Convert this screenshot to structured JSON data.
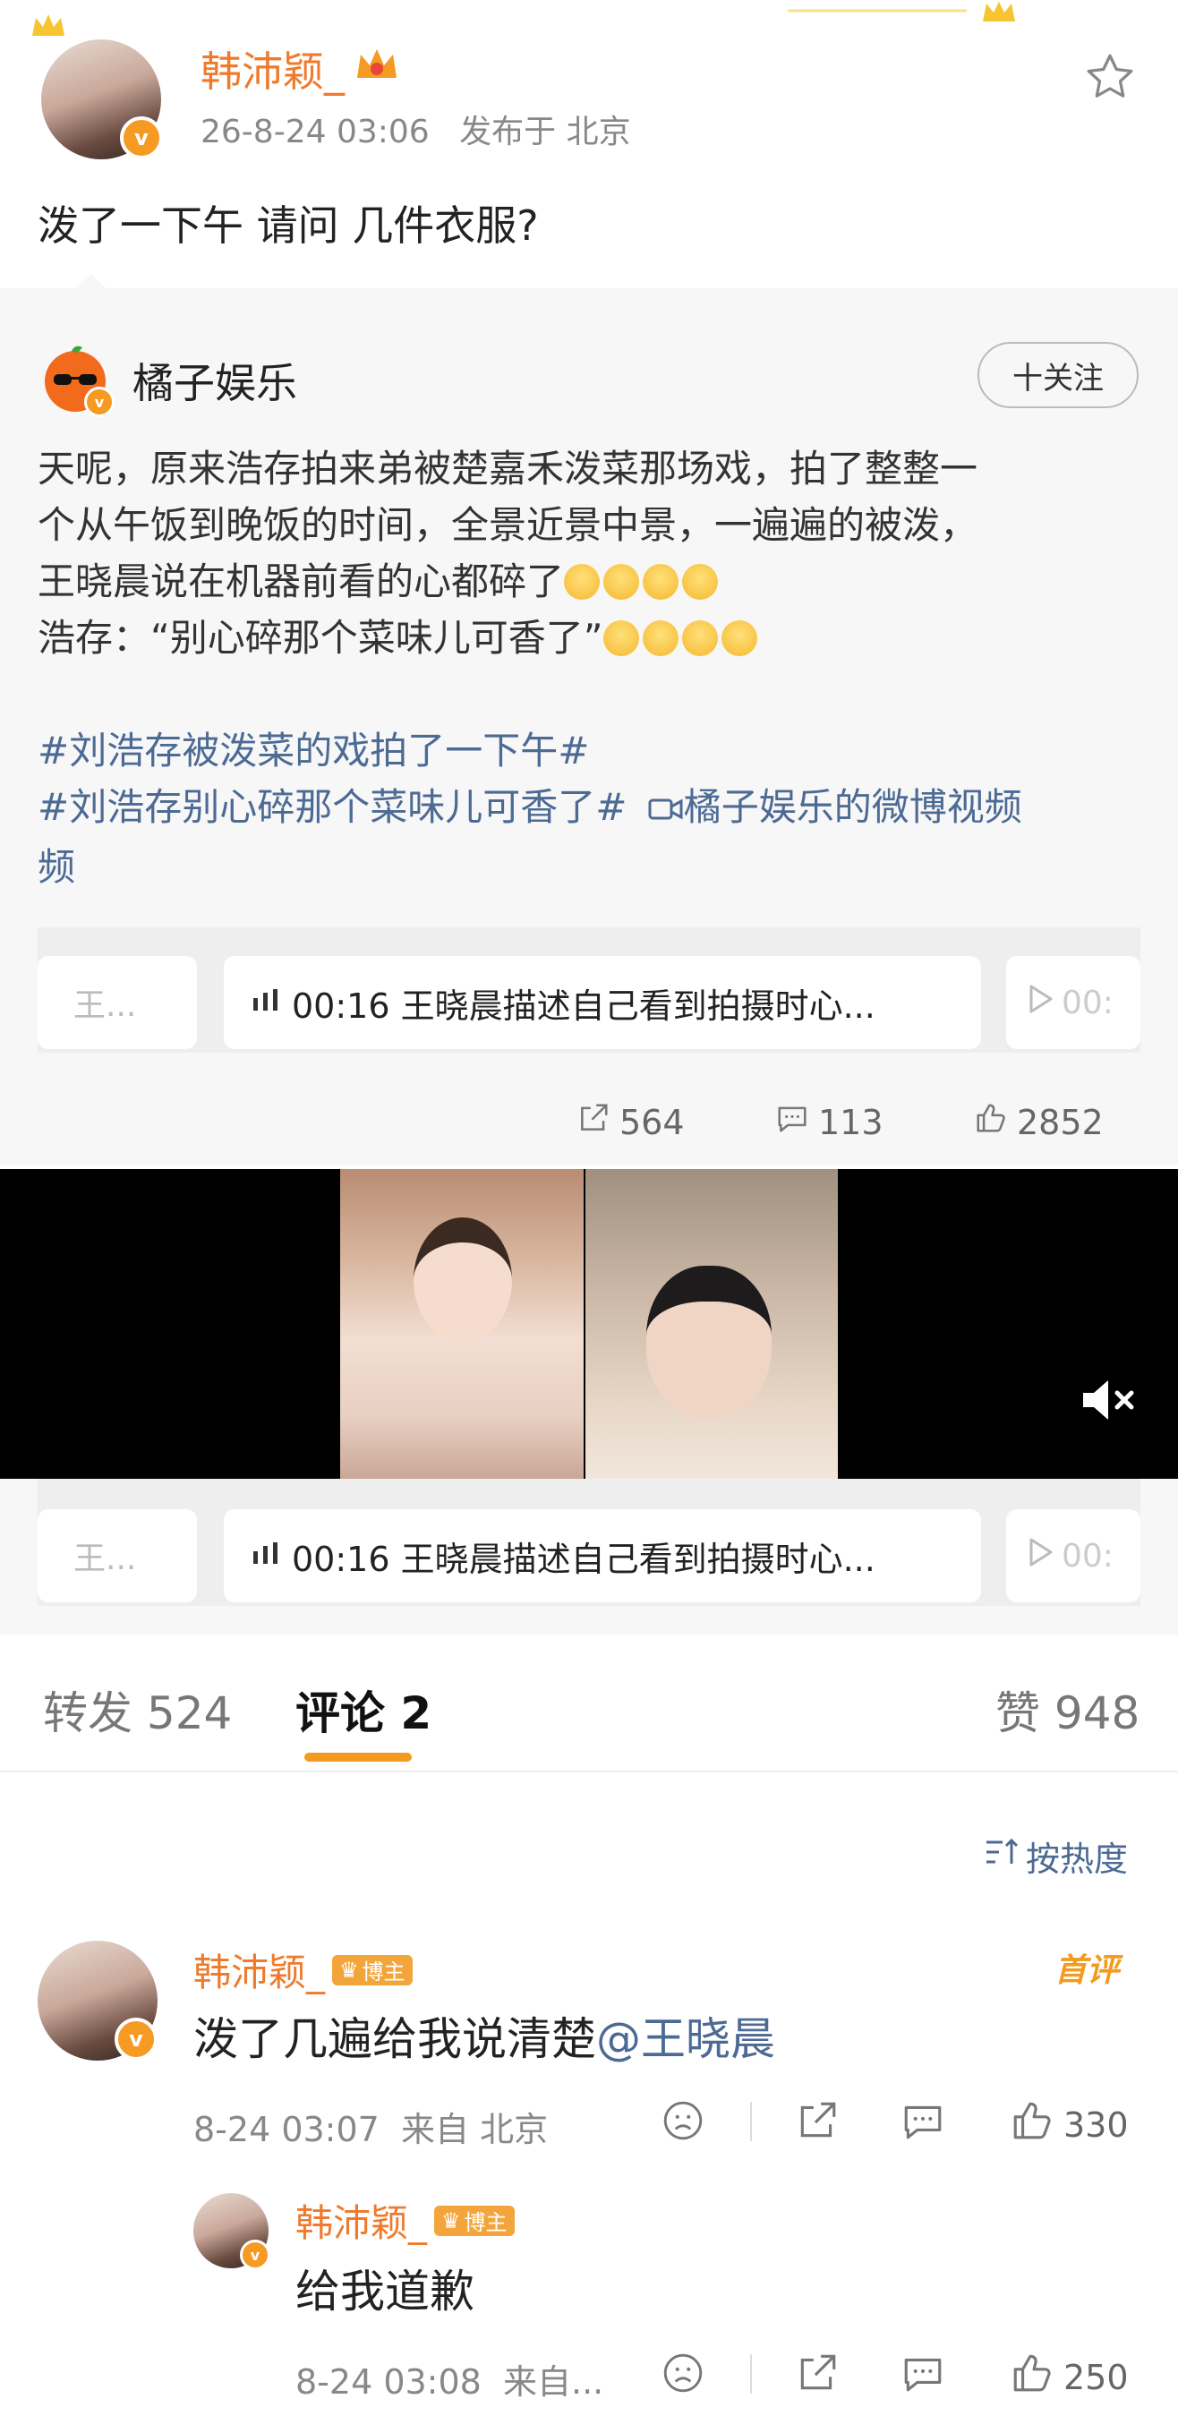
{
  "post": {
    "author": "韩沛颖_",
    "time": "26-8-24 03:06",
    "location": "发布于 北京",
    "text": "泼了一下午 请问 几件衣服?"
  },
  "repost": {
    "author": "橘子娱乐",
    "follow_label": "十关注",
    "line1": "天呢，原来浩存拍来弟被楚嘉禾泼菜那场戏，拍了整整一",
    "line2": "个从午饭到晚饭的时间，全景近景中景，一遍遍的被泼，",
    "line3": "王晓晨说在机器前看的心都碎了",
    "line4": "浩存：“别心碎那个菜味儿可香了”",
    "hashtag1": "#刘浩存被泼菜的戏拍了一下午#",
    "hashtag2": "#刘浩存别心碎那个菜味儿可香了#",
    "video_link": "橘子娱乐的微博视频",
    "video_link_tail": "频",
    "chip_left": "王...",
    "chip_main": "00:16 王晓晨描述自己看到拍摄时心...",
    "chip_right": "00:",
    "reposts": "564",
    "comments": "113",
    "likes": "2852"
  },
  "tabs": {
    "repost": "转发 524",
    "comment": "评论 2",
    "like": "赞 948"
  },
  "sort_label": "按热度",
  "comments": [
    {
      "author": "韩沛颖_",
      "badge": "博主",
      "tag": "首评",
      "text": "泼了几遍给我说清楚",
      "mention": "@王晓晨",
      "meta": "8-24 03:07  来自 北京",
      "likes": "330"
    },
    {
      "author": "韩沛颖_",
      "badge": "博主",
      "text": "给我道歉",
      "meta": "8-24 03:08  来自...",
      "likes": "250"
    }
  ],
  "colors": {
    "accent": "#f07a2b",
    "link": "#4c6a94",
    "tab_underline": "#f39b1f"
  }
}
